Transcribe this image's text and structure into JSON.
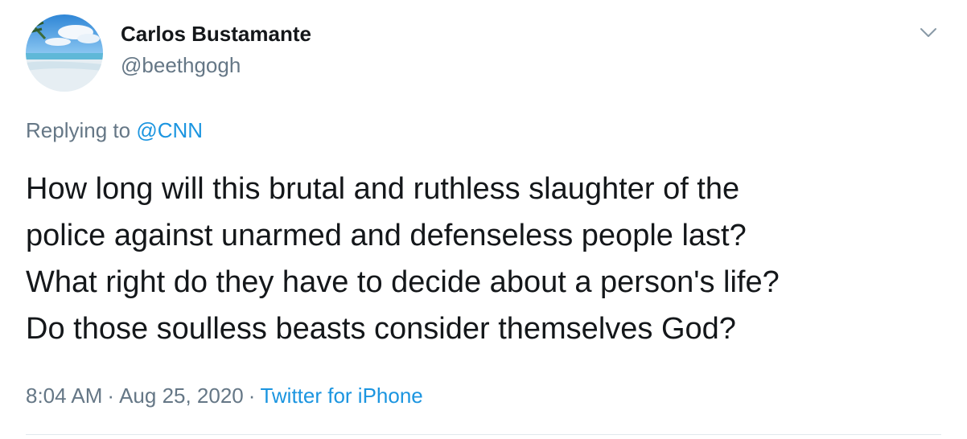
{
  "author": {
    "name": "Carlos Bustamante",
    "handle": "@beethgogh",
    "avatar_icon": "beach-avatar-icon"
  },
  "reply": {
    "prefix": "Replying to ",
    "mention": "@CNN"
  },
  "tweet": {
    "text": "How long will this brutal and ruthless slaughter of the\npolice against unarmed and defenseless people last?\nWhat right do they have to decide about a person's life?\nDo those soulless beasts consider themselves God?"
  },
  "meta": {
    "time": "8:04 AM",
    "separator": "·",
    "date": "Aug 25, 2020",
    "source": "Twitter for iPhone"
  },
  "colors": {
    "text_primary": "#14171a",
    "text_secondary": "#657786",
    "link": "#1b95e0",
    "divider": "#e1e8ed"
  },
  "menu_icon": "chevron-down-icon"
}
